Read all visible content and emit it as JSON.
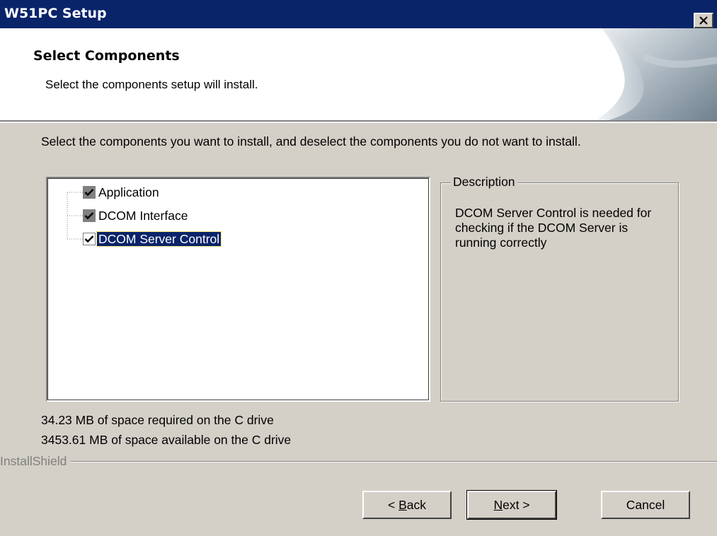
{
  "window": {
    "title": "W51PC Setup",
    "close_icon": "close-x-icon"
  },
  "header": {
    "title": "Select Components",
    "subtitle": "Select the components setup will install.",
    "graphic_icon": "page-curl-graphic"
  },
  "main": {
    "instruction": "Select the components you want to install, and deselect the components you do not want to install."
  },
  "components": [
    {
      "label": "Application",
      "checked": true,
      "state": "grayed"
    },
    {
      "label": "DCOM Interface",
      "checked": true,
      "state": "grayed"
    },
    {
      "label": "DCOM Server Control",
      "checked": true,
      "state": "selected"
    }
  ],
  "description": {
    "legend": "Description",
    "text": "DCOM Server Control is needed for checking if the DCOM Server is running correctly"
  },
  "space": {
    "required": "34.23 MB of space required on the C drive",
    "available": "3453.61 MB of space available on the C drive"
  },
  "footer": {
    "brand": "InstallShield"
  },
  "buttons": {
    "back_prefix": "< ",
    "back_accel": "B",
    "back_rest": "ack",
    "next_accel": "N",
    "next_rest": "ext >",
    "cancel": "Cancel"
  },
  "colors": {
    "titlebar": "#0a246a",
    "dialog_bg": "#d4d0c8",
    "selection": "#0a246a"
  }
}
